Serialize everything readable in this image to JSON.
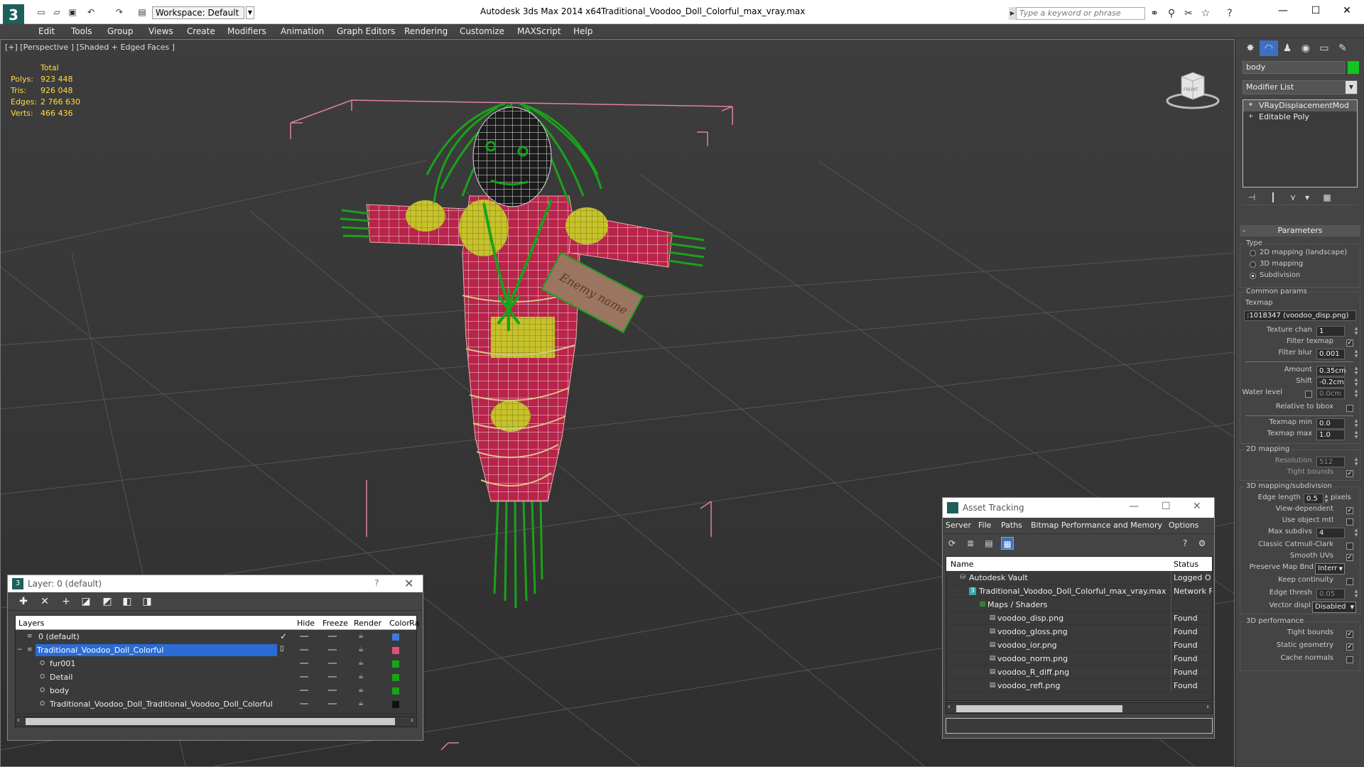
{
  "titlebar": {
    "workspace": "Workspace: Default",
    "app_title": "Autodesk 3ds Max  2014 x64",
    "file_title": "Traditional_Voodoo_Doll_Colorful_max_vray.max",
    "search_placeholder": "Type a keyword or phrase"
  },
  "menu": [
    "Edit",
    "Tools",
    "Group",
    "Views",
    "Create",
    "Modifiers",
    "Animation",
    "Graph Editors",
    "Rendering",
    "Customize",
    "MAXScript",
    "Help"
  ],
  "viewport": {
    "label": "[+] [Perspective ] [Shaded + Edged Faces ]",
    "stats_header": "Total",
    "stats": [
      {
        "label": "Polys:",
        "value": "923 448"
      },
      {
        "label": "Tris:",
        "value": "926 048"
      },
      {
        "label": "Edges:",
        "value": "2 766 630"
      },
      {
        "label": "Verts:",
        "value": "466 436"
      }
    ],
    "viewcube_label": "FRONT",
    "tag_text": "Enemy name"
  },
  "command_panel": {
    "object_name": "body",
    "object_color": "#13c51e",
    "modifier_list": "Modifier List",
    "stack": [
      "VRayDisplacementMod",
      "Editable Poly"
    ],
    "params_title": "Parameters",
    "type_label": "Type",
    "type_options": [
      "2D mapping (landscape)",
      "3D mapping",
      "Subdivision"
    ],
    "common_label": "Common params",
    "texmap_label": "Texmap",
    "texmap_value": ":1018347 (voodoo_disp.png)",
    "texture_chan_label": "Texture chan",
    "texture_chan_value": "1",
    "filter_texmap_label": "Filter texmap",
    "filter_blur_label": "Filter blur",
    "filter_blur_value": "0.001",
    "amount_label": "Amount",
    "amount_value": "0.35cm",
    "shift_label": "Shift",
    "shift_value": "-0.2cm",
    "water_label": "Water level",
    "water_value": "0.0cm",
    "rel_bbox_label": "Relative to bbox",
    "texmap_min_label": "Texmap min",
    "texmap_min_value": "0.0",
    "texmap_max_label": "Texmap max",
    "texmap_max_value": "1.0",
    "map2d_label": "2D mapping",
    "resolution_label": "Resolution",
    "resolution_value": "512",
    "tight_bounds_label": "Tight bounds",
    "map3d_label": "3D mapping/subdivision",
    "edge_length_label": "Edge length",
    "edge_length_value": "0.5",
    "pixels_label": "pixels",
    "view_dep_label": "View-dependent",
    "use_obj_mtl_label": "Use object mtl",
    "max_subdivs_label": "Max subdivs",
    "max_subdivs_value": "4",
    "classic_cc_label": "Classic Catmull-Clark",
    "smooth_uvs_label": "Smooth UVs",
    "preserve_label": "Preserve Map Bnd",
    "preserve_value": "Interr",
    "keep_cont_label": "Keep continuity",
    "edge_thresh_label": "Edge thresh",
    "edge_thresh_value": "0.05",
    "vector_label": "Vector displ",
    "vector_value": "Disabled",
    "perf_label": "3D performance",
    "perf_tight_label": "Tight bounds",
    "static_geo_label": "Static geometry",
    "cache_label": "Cache normals"
  },
  "layer_dialog": {
    "title": "Layer: 0 (default)",
    "help": "?",
    "headers": {
      "layers": "Layers",
      "hide": "Hide",
      "freeze": "Freeze",
      "render": "Render",
      "color": "Color",
      "radiosity": "Ra"
    },
    "rows": [
      {
        "name": "0 (default)",
        "color": "#3a7ae0"
      },
      {
        "name": "Traditional_Voodoo_Doll_Colorful",
        "color": "#e0507a"
      },
      {
        "name": "fur001",
        "color": "#1aa21a"
      },
      {
        "name": "Detail",
        "color": "#1aa21a"
      },
      {
        "name": "body",
        "color": "#1aa21a"
      },
      {
        "name": "Traditional_Voodoo_Doll_Traditional_Voodoo_Doll_Colorful",
        "color": "#111111"
      }
    ]
  },
  "asset_dialog": {
    "title": "Asset Tracking",
    "menu": [
      "Server",
      "File",
      "Paths",
      "Bitmap Performance and Memory",
      "Options"
    ],
    "headers": {
      "name": "Name",
      "status": "Status"
    },
    "rows": [
      {
        "name": "Autodesk Vault",
        "status": "Logged O"
      },
      {
        "name": "Traditional_Voodoo_Doll_Colorful_max_vray.max",
        "status": "Network F"
      },
      {
        "name": "Maps / Shaders",
        "status": ""
      },
      {
        "name": "voodoo_disp.png",
        "status": "Found"
      },
      {
        "name": "voodoo_gloss.png",
        "status": "Found"
      },
      {
        "name": "voodoo_ior.png",
        "status": "Found"
      },
      {
        "name": "voodoo_norm.png",
        "status": "Found"
      },
      {
        "name": "voodoo_R_diff.png",
        "status": "Found"
      },
      {
        "name": "voodoo_refl.png",
        "status": "Found"
      }
    ]
  }
}
